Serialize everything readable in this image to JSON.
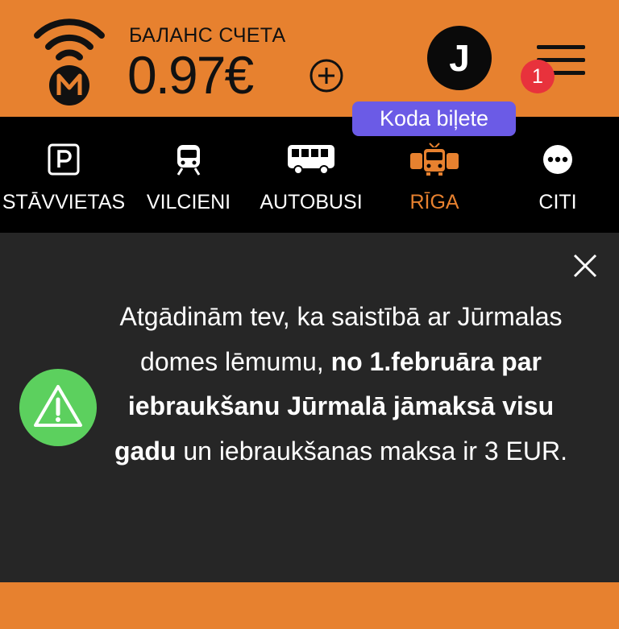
{
  "header": {
    "balance_label": "БАЛАНС СЧЕТА",
    "balance_value": "0.97€",
    "avatar_initial": "J",
    "notification_count": "1",
    "tooltip": "Koda biļete"
  },
  "nav": {
    "items": [
      {
        "label": "STĀVVIETAS",
        "icon": "parking-icon",
        "active": false
      },
      {
        "label": "VILCIENI",
        "icon": "train-icon",
        "active": false
      },
      {
        "label": "AUTOBUSI",
        "icon": "bus-icon",
        "active": false
      },
      {
        "label": "RĪGA",
        "icon": "city-transport-icon",
        "active": true
      },
      {
        "label": "CITI",
        "icon": "more-icon",
        "active": false
      }
    ]
  },
  "notice": {
    "text_1": "Atgādinām tev, ka saistībā ar Jūrmalas domes lēmumu, ",
    "text_bold": "no 1.februāra par iebraukšanu Jūrmalā jāmaksā visu gadu",
    "text_2": " un iebraukšanas maksa ir 3 EUR."
  },
  "colors": {
    "brand_orange": "#E7812F",
    "nav_background": "#000000",
    "notice_background": "#262626",
    "warning_green": "#5CD05E",
    "tooltip_purple": "#6B5BE6",
    "badge_red": "#E8323C"
  }
}
